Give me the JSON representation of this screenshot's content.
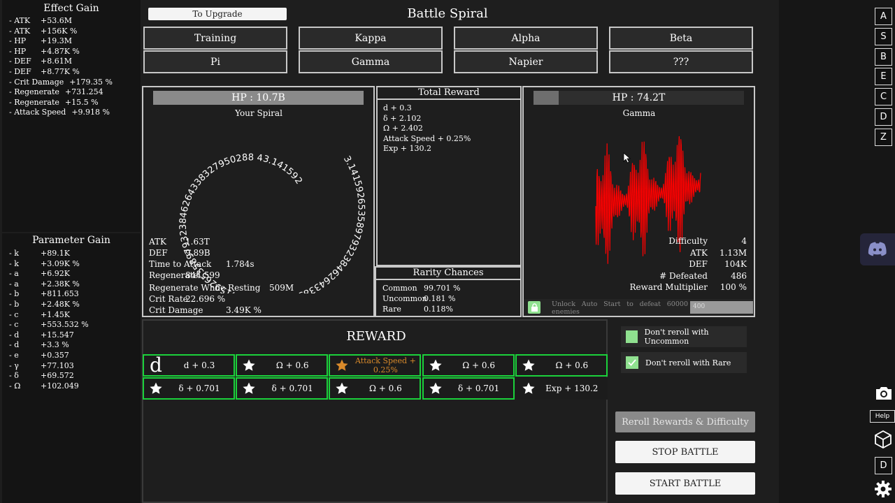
{
  "effect_gain": {
    "title": "Effect Gain",
    "rows": [
      {
        "name": "- ATK",
        "value": "+53.6M"
      },
      {
        "name": "- ATK",
        "value": "+156K %"
      },
      {
        "name": "- HP",
        "value": "+19.3M"
      },
      {
        "name": "- HP",
        "value": "+4.87K %"
      },
      {
        "name": "- DEF",
        "value": "+8.61M"
      },
      {
        "name": "- DEF",
        "value": "+8.77K %"
      },
      {
        "name": "- Crit Damage",
        "value": "+179.35 %"
      },
      {
        "name": "- Regenerate",
        "value": "+731.254"
      },
      {
        "name": "- Regenerate",
        "value": "+15.5 %"
      },
      {
        "name": "- Attack Speed",
        "value": "+9.918 %"
      }
    ]
  },
  "parameter_gain": {
    "title": "Parameter Gain",
    "rows": [
      {
        "name": "- k",
        "value": "+89.1K"
      },
      {
        "name": "- k",
        "value": "+3.09K %"
      },
      {
        "name": "- a",
        "value": "+6.92K"
      },
      {
        "name": "- a",
        "value": "+2.38K %"
      },
      {
        "name": "- b",
        "value": "+811.653"
      },
      {
        "name": "- b",
        "value": "+2.48K %"
      },
      {
        "name": "- c",
        "value": "+1.45K"
      },
      {
        "name": "- c",
        "value": "+553.532 %"
      },
      {
        "name": "- d",
        "value": "+15.547"
      },
      {
        "name": "- d",
        "value": "+3.3 %"
      },
      {
        "name": "- e",
        "value": "+0.357"
      },
      {
        "name": "- γ",
        "value": "+77.103"
      },
      {
        "name": "- δ",
        "value": "+69.572"
      },
      {
        "name": "- Ω",
        "value": "+102.049"
      }
    ]
  },
  "header": {
    "upgrade_button": "To Upgrade",
    "title": "Battle Spiral"
  },
  "stages": [
    "Training",
    "Kappa",
    "Alpha",
    "Beta",
    "Pi",
    "Gamma",
    "Napier",
    "???"
  ],
  "player": {
    "hp_label": "HP : 10.7B",
    "hp_fraction": 1.0,
    "spiral_title": "Your Spiral",
    "spiral_text": "3.141592653589793238462643383279502884.14159265358979323846264338327950288 43.141592",
    "stats": [
      {
        "label": "ATK",
        "value": "1.63T"
      },
      {
        "label": "DEF",
        "value": "9.89B"
      },
      {
        "label": "Time to Attack",
        "value": "1.784s"
      },
      {
        "label": "Regenerate",
        "value": "844.599"
      },
      {
        "label": "Regenerate While Resting",
        "value": "509M"
      },
      {
        "label": "Crit Rate",
        "value": "22.696 %"
      },
      {
        "label": "Crit Damage",
        "value": "3.49K %"
      }
    ]
  },
  "total_reward": {
    "title": "Total Reward",
    "lines": [
      "d + 0.3",
      "δ + 2.102",
      "Ω + 2.402",
      "Attack Speed + 0.25%",
      "Exp + 130.2"
    ]
  },
  "rarity": {
    "title": "Rarity Chances",
    "rows": [
      {
        "label": "Common",
        "value": "99.701 %"
      },
      {
        "label": "Uncommon",
        "value": "0.181 %"
      },
      {
        "label": "Rare",
        "value": "0.118%"
      }
    ]
  },
  "enemy": {
    "hp_label": "HP : 74.2T",
    "hp_fraction": 0.12,
    "name": "Gamma",
    "stats": [
      {
        "label": "Difficulty",
        "value": "4"
      },
      {
        "label": "ATK",
        "value": "1.13M"
      },
      {
        "label": "DEF",
        "value": "104K"
      },
      {
        "label": "# Defeated",
        "value": "486"
      },
      {
        "label": "Reward Multiplier",
        "value": "100 %"
      }
    ],
    "auto_start_text": "Unlock Auto Start to defeat 60000 enemies",
    "auto_start_value": "400"
  },
  "reward": {
    "title": "REWARD",
    "cells": [
      {
        "text": "d + 0.3",
        "icon": "letter-d",
        "rarity": "common"
      },
      {
        "text": "Ω + 0.6",
        "icon": "star",
        "rarity": "common"
      },
      {
        "text": "Attack Speed + 0.25%",
        "icon": "star",
        "rarity": "rare"
      },
      {
        "text": "Ω + 0.6",
        "icon": "star",
        "rarity": "common"
      },
      {
        "text": "Ω + 0.6",
        "icon": "star",
        "rarity": "common"
      },
      {
        "text": "δ + 0.701",
        "icon": "star",
        "rarity": "common"
      },
      {
        "text": "δ + 0.701",
        "icon": "star",
        "rarity": "common"
      },
      {
        "text": "Ω + 0.6",
        "icon": "star",
        "rarity": "common"
      },
      {
        "text": "δ + 0.701",
        "icon": "star",
        "rarity": "common"
      },
      {
        "text": "Exp + 130.2",
        "icon": "star",
        "rarity": "common"
      }
    ],
    "icon_letter": "d"
  },
  "options": {
    "uncommon_label": "Don't reroll with Uncommon",
    "rare_label": "Don't reroll with Rare",
    "reroll_button": "Reroll Rewards & Difficulty",
    "stop_button": "STOP BATTLE",
    "start_button": "START BATTLE"
  },
  "side_tabs": [
    "A",
    "S",
    "B",
    "E",
    "C",
    "D",
    "Z"
  ],
  "side_bottom": {
    "help": "Help",
    "d_label": "D"
  },
  "colors": {
    "hp_bar": "#8a8a8a",
    "enemy_graph": "#ff0000",
    "reward_border": "#1bd13b",
    "rare_text": "#d98a2b",
    "toggle_fill": "#8fe08f"
  }
}
